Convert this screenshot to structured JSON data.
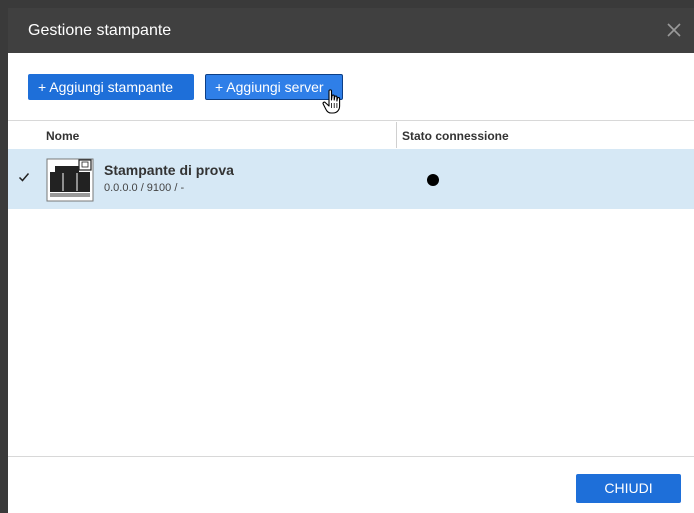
{
  "dialog": {
    "title": "Gestione stampante",
    "close_icon": "close-icon"
  },
  "toolbar": {
    "add_printer_label": "+ Aggiungi stampante",
    "add_server_label": "+ Aggiungi server"
  },
  "table": {
    "columns": [
      "Nome",
      "Stato connessione"
    ],
    "rows": [
      {
        "selected": true,
        "check_icon": "checkmark-icon",
        "icon": "printer-icon",
        "name": "Stampante di prova",
        "address": "0.0.0.0 / 9100 / -",
        "status_icon": "status-dot-icon"
      }
    ]
  },
  "footer": {
    "close_label": "CHIUDI"
  },
  "colors": {
    "titlebar_bg": "#404040",
    "button_blue": "#1e6fd9",
    "selected_row_bg": "#d6e8f5",
    "status_dot": "#000000"
  }
}
